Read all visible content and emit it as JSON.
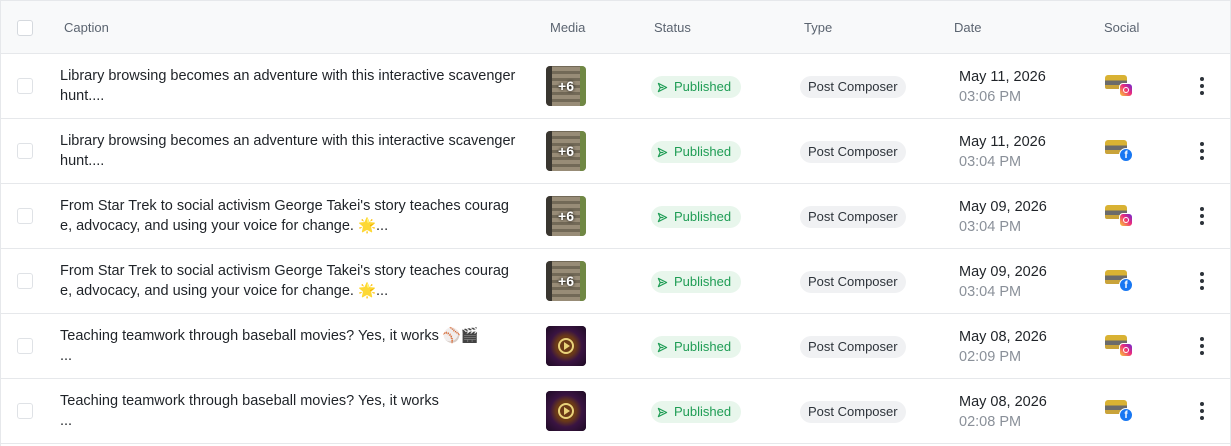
{
  "header": {
    "caption": "Caption",
    "media": "Media",
    "status": "Status",
    "type": "Type",
    "date": "Date",
    "social": "Social"
  },
  "rows": [
    {
      "caption_lines": [
        "Library browsing becomes an adventure with this interactive scavenger",
        "hunt...."
      ],
      "media": {
        "kind": "gallery",
        "count": "+6"
      },
      "status": "Published",
      "type": "Post Composer",
      "date": "May 11, 2026",
      "time": "03:06 PM",
      "network": "instagram"
    },
    {
      "caption_lines": [
        "Library browsing becomes an adventure with this interactive scavenger",
        "hunt...."
      ],
      "media": {
        "kind": "gallery",
        "count": "+6"
      },
      "status": "Published",
      "type": "Post Composer",
      "date": "May 11, 2026",
      "time": "03:04 PM",
      "network": "facebook"
    },
    {
      "caption_lines": [
        "From Star Trek to social activism George Takei's story teaches courag",
        "e, advocacy, and using your voice for change. 🌟..."
      ],
      "media": {
        "kind": "gallery",
        "count": "+6"
      },
      "status": "Published",
      "type": "Post Composer",
      "date": "May 09, 2026",
      "time": "03:04 PM",
      "network": "instagram"
    },
    {
      "caption_lines": [
        "From Star Trek to social activism George Takei's story teaches courag",
        "e, advocacy, and using your voice for change. 🌟..."
      ],
      "media": {
        "kind": "gallery",
        "count": "+6"
      },
      "status": "Published",
      "type": "Post Composer",
      "date": "May 09, 2026",
      "time": "03:04 PM",
      "network": "facebook"
    },
    {
      "caption_lines": [
        "Teaching teamwork through baseball movies? Yes, it works ⚾🎬",
        "..."
      ],
      "media": {
        "kind": "video",
        "count": ""
      },
      "status": "Published",
      "type": "Post Composer",
      "date": "May 08, 2026",
      "time": "02:09 PM",
      "network": "instagram"
    },
    {
      "caption_lines": [
        "Teaching teamwork through baseball movies? Yes, it works",
        "..."
      ],
      "media": {
        "kind": "video",
        "count": ""
      },
      "status": "Published",
      "type": "Post Composer",
      "date": "May 08, 2026",
      "time": "02:08 PM",
      "network": "facebook"
    }
  ],
  "colors": {
    "status_bg": "#e8f6ec",
    "status_fg": "#1f9d55",
    "type_bg": "#f0f1f3",
    "facebook": "#1877f2",
    "instagram": "#ee2a7b"
  }
}
